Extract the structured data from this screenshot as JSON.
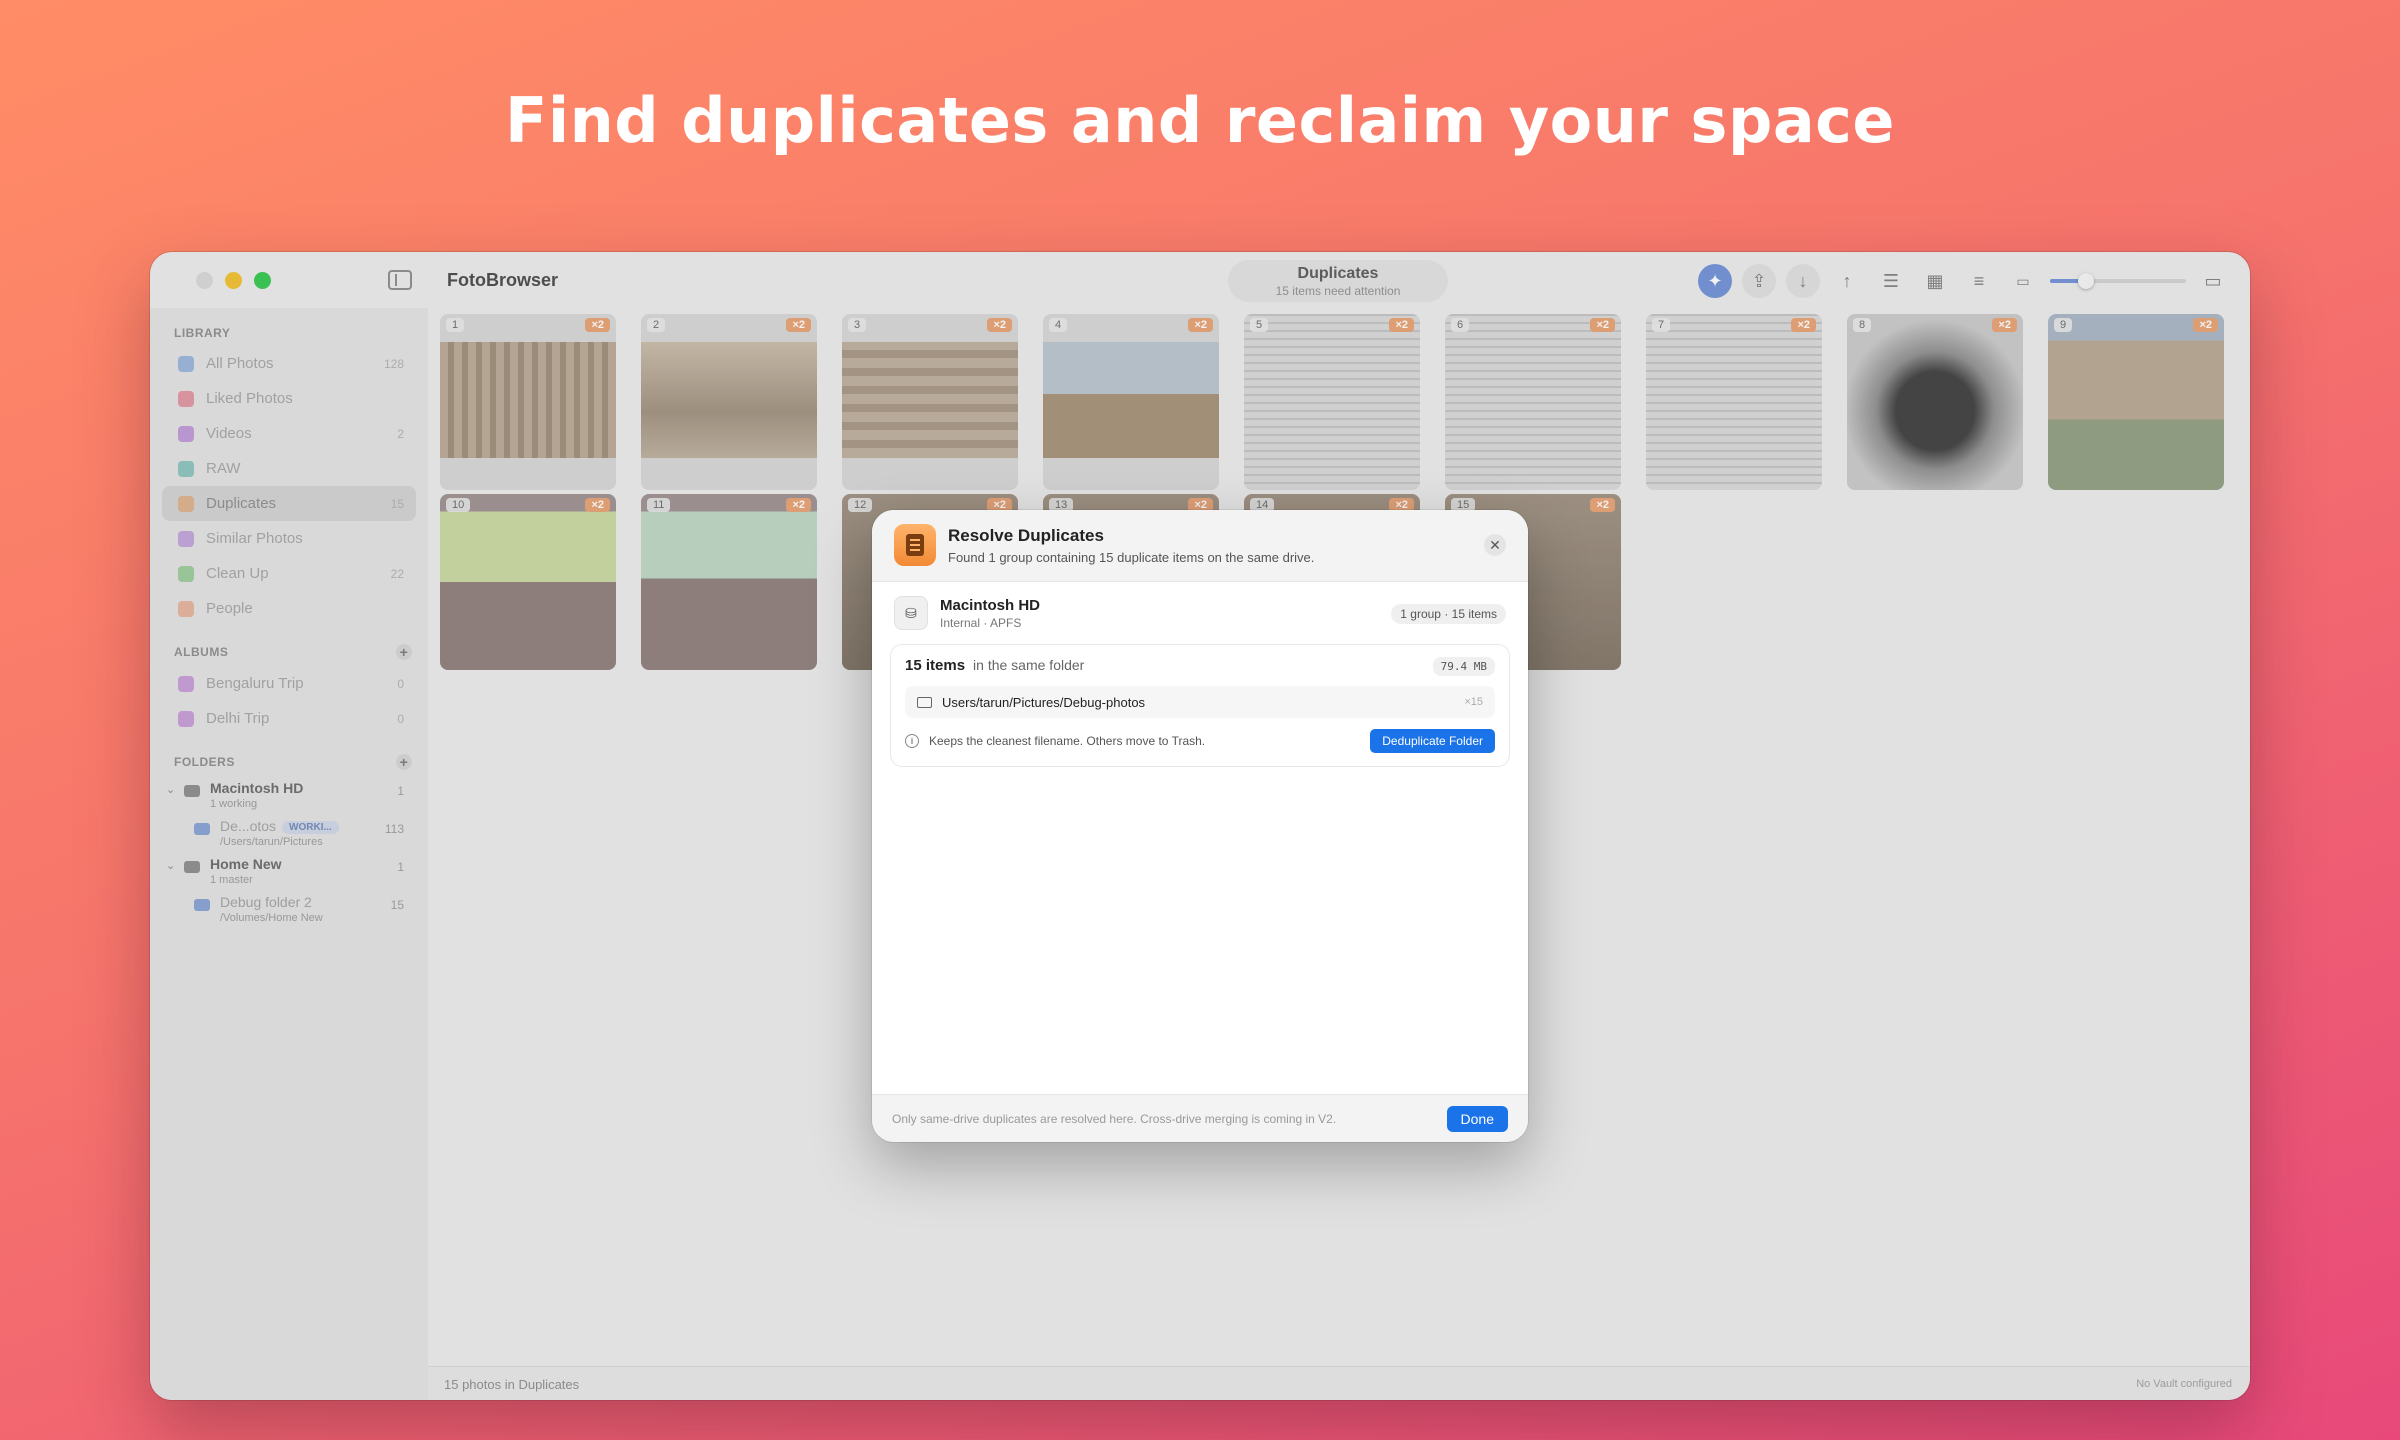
{
  "headline": "Find duplicates and reclaim your space",
  "app": {
    "name": "FotoBrowser",
    "title": "Duplicates",
    "subtitle": "15 items need attention"
  },
  "sidebar": {
    "library_title": "LIBRARY",
    "library": [
      {
        "label": "All Photos",
        "count": "128",
        "icon": "photos-icon",
        "color": "#5b8dd6"
      },
      {
        "label": "Liked Photos",
        "count": "",
        "icon": "heart-icon",
        "color": "#e0566a"
      },
      {
        "label": "Videos",
        "count": "2",
        "icon": "video-icon",
        "color": "#a25ad0"
      },
      {
        "label": "RAW",
        "count": "",
        "icon": "aperture-icon",
        "color": "#3fa7a0"
      },
      {
        "label": "Duplicates",
        "count": "15",
        "icon": "duplicate-icon",
        "color": "#e8944b"
      },
      {
        "label": "Similar Photos",
        "count": "",
        "icon": "similar-icon",
        "color": "#a56dd6"
      },
      {
        "label": "Clean Up",
        "count": "22",
        "icon": "broom-icon",
        "color": "#5cb85c"
      },
      {
        "label": "People",
        "count": "",
        "icon": "person-icon",
        "color": "#e88b5e"
      }
    ],
    "albums_title": "ALBUMS",
    "albums": [
      {
        "label": "Bengaluru Trip",
        "count": "0"
      },
      {
        "label": "Delhi Trip",
        "count": "0"
      }
    ],
    "folders_title": "FOLDERS",
    "folders": [
      {
        "name": "Macintosh HD",
        "sub": "1 working",
        "count": "1",
        "child": {
          "name": "De...otos",
          "badge": "WORKI...",
          "sub": "/Users/tarun/Pictures",
          "count": "113"
        }
      },
      {
        "name": "Home New",
        "sub": "1 master",
        "count": "1",
        "child": {
          "name": "Debug folder 2",
          "badge": "",
          "sub": "/Volumes/Home New",
          "count": "15"
        }
      }
    ]
  },
  "grid": {
    "tiles": [
      {
        "num": "1",
        "dup": "×2",
        "kind": "stone1"
      },
      {
        "num": "2",
        "dup": "×2",
        "kind": "stone2"
      },
      {
        "num": "3",
        "dup": "×2",
        "kind": "stone3"
      },
      {
        "num": "4",
        "dup": "×2",
        "kind": "chariot"
      },
      {
        "num": "5",
        "dup": "×2",
        "kind": "paper"
      },
      {
        "num": "6",
        "dup": "×2",
        "kind": "paper"
      },
      {
        "num": "7",
        "dup": "×2",
        "kind": "paper"
      },
      {
        "num": "8",
        "dup": "×2",
        "kind": "dark"
      },
      {
        "num": "9",
        "dup": "×2",
        "kind": "building"
      },
      {
        "num": "10",
        "dup": "×2",
        "kind": "slide"
      },
      {
        "num": "11",
        "dup": "×2",
        "kind": "slide2"
      },
      {
        "num": "12",
        "dup": "×2",
        "kind": "ground"
      },
      {
        "num": "13",
        "dup": "×2",
        "kind": "ground"
      },
      {
        "num": "14",
        "dup": "×2",
        "kind": "ground"
      },
      {
        "num": "15",
        "dup": "×2",
        "kind": "ground"
      }
    ]
  },
  "statusbar": {
    "left": "15 photos in Duplicates",
    "right": "No Vault configured"
  },
  "modal": {
    "title": "Resolve Duplicates",
    "subtitle": "Found 1 group containing 15 duplicate items on the same drive.",
    "drive": {
      "name": "Macintosh HD",
      "sub": "Internal · APFS",
      "pill": "1 group · 15 items"
    },
    "group": {
      "count": "15 items",
      "label": "in the same folder",
      "size": "79.4 MB",
      "path": "Users/tarun/Pictures/Debug-photos",
      "path_count": "×15",
      "info": "Keeps the cleanest filename. Others move to Trash.",
      "action": "Deduplicate Folder"
    },
    "footer": "Only same-drive duplicates are resolved here. Cross-drive merging is coming in V2.",
    "done": "Done"
  }
}
